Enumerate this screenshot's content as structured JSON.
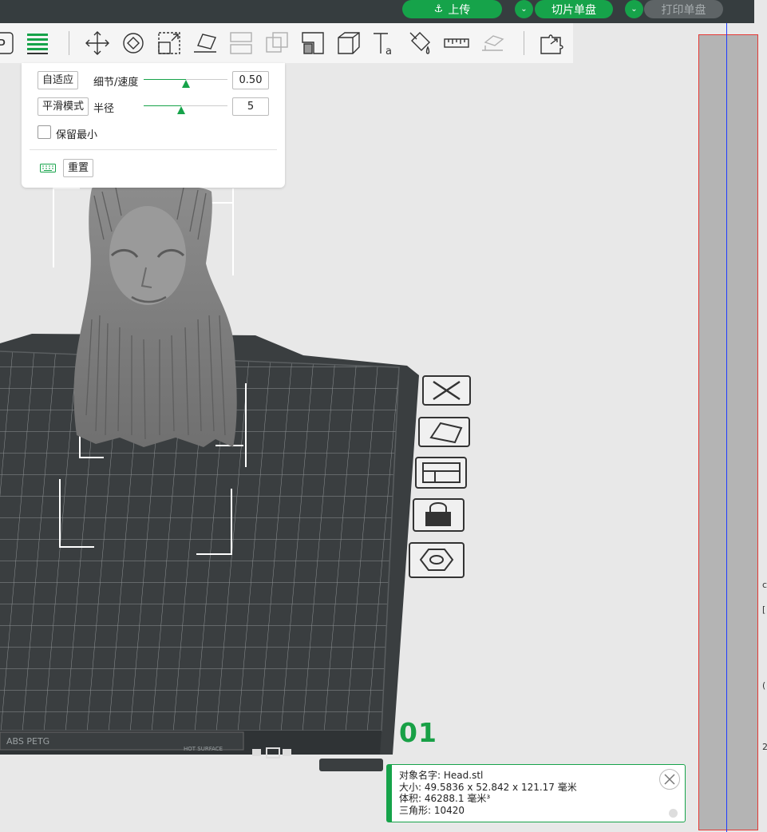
{
  "topbar": {
    "upload_label": "上传",
    "slice_label": "切片单盘",
    "print_label": "打印单盘"
  },
  "toolbar": {
    "tools": [
      "p-icon",
      "layers-icon",
      "move-icon",
      "rotate-icon",
      "scale-icon",
      "place-on-face-icon",
      "split-icon",
      "boolean-icon",
      "cut-icon",
      "cube-icon",
      "text-icon",
      "paint-icon",
      "measure-icon",
      "support-paint-icon",
      "assemble-icon"
    ]
  },
  "panel": {
    "adaptive_label": "自适应",
    "detail_label": "细节/速度",
    "detail_value": "0.50",
    "detail_fraction": 0.5,
    "smooth_label": "平滑模式",
    "radius_label": "半径",
    "radius_value": "5",
    "radius_fraction": 0.45,
    "keep_min_label": "保留最小",
    "reset_label": "重置"
  },
  "plate": {
    "number": "01",
    "label_left": "ABS PETG",
    "label_mid": "HOT SURFACE"
  },
  "info": {
    "name_label": "对象名字:",
    "name_value": "Head.stl",
    "size_label": "大小:",
    "size_value": "49.5836 x 52.842 x 121.17 毫米",
    "volume_label": "体积:",
    "volume_value": "46288.1 毫米³",
    "triangles_label": "三角形:",
    "triangles_value": "10420"
  },
  "edge": {
    "glyph_a": "c",
    "glyph_b": "[",
    "glyph_c": "(",
    "glyph_d": "2"
  },
  "colors": {
    "accent": "#16a34a",
    "topbar": "#363d3f",
    "plate": "#3a3e40"
  }
}
